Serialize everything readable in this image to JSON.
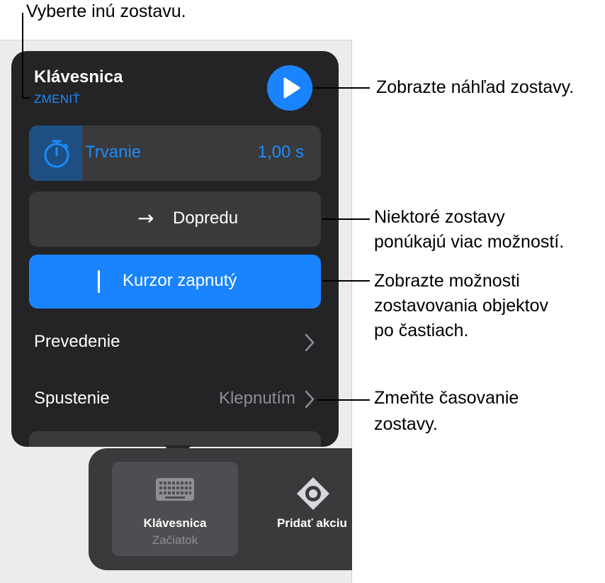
{
  "callouts": {
    "top": "Vyberte inú zostavu.",
    "preview": "Zobrazte náhľad zostavy.",
    "options_line1": "Niektoré zostavy",
    "options_line2": "ponúkajú viac možností.",
    "build_line1": "Zobrazte možnosti",
    "build_line2": "zostavovania objektov",
    "build_line3": "po častiach.",
    "timing_line1": "Zmeňte časovanie",
    "timing_line2": "zostavy."
  },
  "popover": {
    "title": "Klávesnica",
    "change_label": "ZMENIŤ",
    "duration_label": "Trvanie",
    "duration_value": "1,00 s",
    "direction_label": "Dopredu",
    "direction_arrow": "→",
    "cursor_label": "Kurzor zapnutý",
    "delivery_label": "Prevedenie",
    "start_label": "Spustenie",
    "start_value": "Klepnutím"
  },
  "toolbar": {
    "keyboard_label": "Klávesnica",
    "keyboard_sub": "Začiatok",
    "add_action_label": "Pridať akciu"
  },
  "colors": {
    "accent": "#1a84ff",
    "popover_bg": "#242426",
    "control_bg": "#3a3a3c",
    "secondary_text": "#8e8e93"
  },
  "icons": {
    "play": "play-icon",
    "timer": "stopwatch-icon",
    "arrow": "arrow-right-icon",
    "chevron": "chevron-right-icon",
    "keyboard": "keyboard-icon",
    "add_action": "add-action-icon"
  }
}
